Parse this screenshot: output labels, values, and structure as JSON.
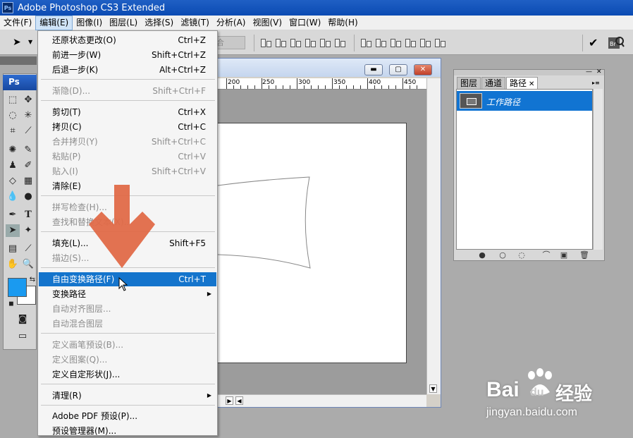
{
  "app": {
    "title": "Adobe Photoshop CS3 Extended",
    "logo": "Ps"
  },
  "menubar": {
    "items": [
      "文件(F)",
      "编辑(E)",
      "图像(I)",
      "图层(L)",
      "选择(S)",
      "滤镜(T)",
      "分析(A)",
      "视图(V)",
      "窗口(W)",
      "帮助(H)"
    ],
    "active_index": 1
  },
  "edit_menu": {
    "items": [
      {
        "label": "还原状态更改(O)",
        "shortcut": "Ctrl+Z",
        "disabled": false
      },
      {
        "label": "前进一步(W)",
        "shortcut": "Shift+Ctrl+Z",
        "disabled": false
      },
      {
        "label": "后退一步(K)",
        "shortcut": "Alt+Ctrl+Z",
        "disabled": false
      },
      {
        "label": "渐隐(D)...",
        "shortcut": "Shift+Ctrl+F",
        "disabled": true
      },
      {
        "label": "剪切(T)",
        "shortcut": "Ctrl+X",
        "disabled": false
      },
      {
        "label": "拷贝(C)",
        "shortcut": "Ctrl+C",
        "disabled": false
      },
      {
        "label": "合并拷贝(Y)",
        "shortcut": "Shift+Ctrl+C",
        "disabled": true
      },
      {
        "label": "粘贴(P)",
        "shortcut": "Ctrl+V",
        "disabled": true
      },
      {
        "label": "贴入(I)",
        "shortcut": "Shift+Ctrl+V",
        "disabled": true
      },
      {
        "label": "清除(E)",
        "shortcut": "",
        "disabled": false
      },
      {
        "label": "拼写检查(H)...",
        "shortcut": "",
        "disabled": true
      },
      {
        "label": "查找和替换文本(X)...",
        "shortcut": "",
        "disabled": true
      },
      {
        "label": "填充(L)...",
        "shortcut": "Shift+F5",
        "disabled": false
      },
      {
        "label": "描边(S)...",
        "shortcut": "",
        "disabled": true
      },
      {
        "label": "自由变换路径(F)",
        "shortcut": "Ctrl+T",
        "disabled": false,
        "highlighted": true
      },
      {
        "label": "变换路径",
        "shortcut": "",
        "disabled": false,
        "submenu": true
      },
      {
        "label": "自动对齐图层...",
        "shortcut": "",
        "disabled": true
      },
      {
        "label": "自动混合图层",
        "shortcut": "",
        "disabled": true
      },
      {
        "label": "定义画笔预设(B)...",
        "shortcut": "",
        "disabled": true
      },
      {
        "label": "定义图案(Q)...",
        "shortcut": "",
        "disabled": true
      },
      {
        "label": "定义自定形状(J)...",
        "shortcut": "",
        "disabled": false
      },
      {
        "label": "清理(R)",
        "shortcut": "",
        "disabled": false,
        "submenu": true
      },
      {
        "label": "Adobe PDF 预设(P)...",
        "shortcut": "",
        "disabled": false
      },
      {
        "label": "预设管理器(M)...",
        "shortcut": "",
        "disabled": false
      }
    ]
  },
  "document": {
    "ruler_labels": [
      "200",
      "250",
      "300",
      "350",
      "400",
      "450"
    ]
  },
  "paths_panel": {
    "tabs": [
      "图层",
      "通道",
      "路径"
    ],
    "active_tab": 2,
    "paths": [
      {
        "name": "工作路径",
        "selected": true
      }
    ],
    "footer_icons": [
      "fill-path-icon",
      "stroke-path-icon",
      "load-selection-icon",
      "make-work-path-icon",
      "new-path-icon",
      "delete-path-icon"
    ]
  },
  "colors": {
    "foreground": "#1a9af0",
    "background": "#ffffff",
    "highlight": "#1474cc",
    "annotation_arrow": "#e06a48"
  },
  "watermark": {
    "brand": "Bai",
    "brand2": "du",
    "product": "经验",
    "url": "jingyan.baidu.com"
  }
}
